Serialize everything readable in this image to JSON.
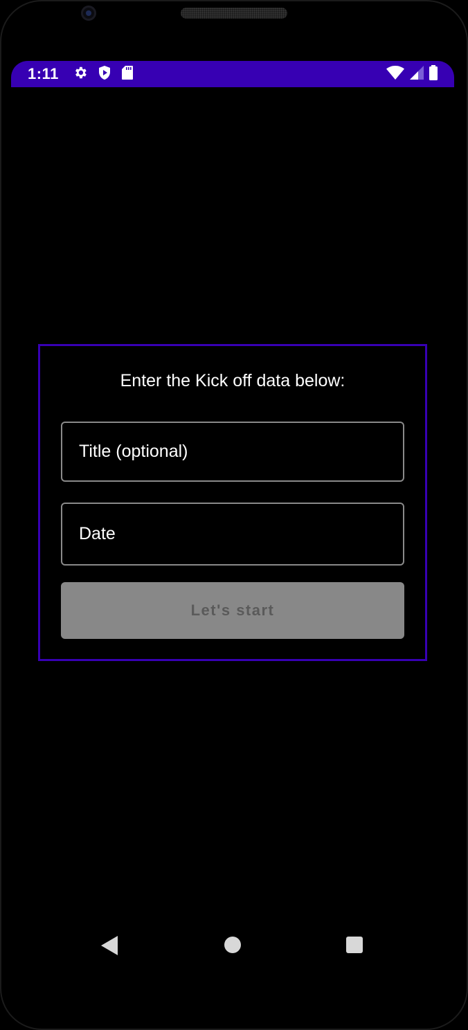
{
  "status_bar": {
    "time": "1:11",
    "left_icons": [
      "settings-icon",
      "play-protect-icon",
      "sd-card-icon"
    ],
    "right_icons": [
      "wifi-icon",
      "cell-signal-icon",
      "battery-icon"
    ],
    "background_color": "#3700b3"
  },
  "form": {
    "heading": "Enter the Kick off data below:",
    "title_field": {
      "placeholder": "Title (optional)",
      "value": ""
    },
    "date_field": {
      "placeholder": "Date",
      "value": ""
    },
    "start_button": {
      "label": "Let's start",
      "enabled": false
    },
    "border_color": "#3700b3"
  },
  "nav_bar": {
    "buttons": [
      "back-icon",
      "home-icon",
      "recents-icon"
    ]
  }
}
